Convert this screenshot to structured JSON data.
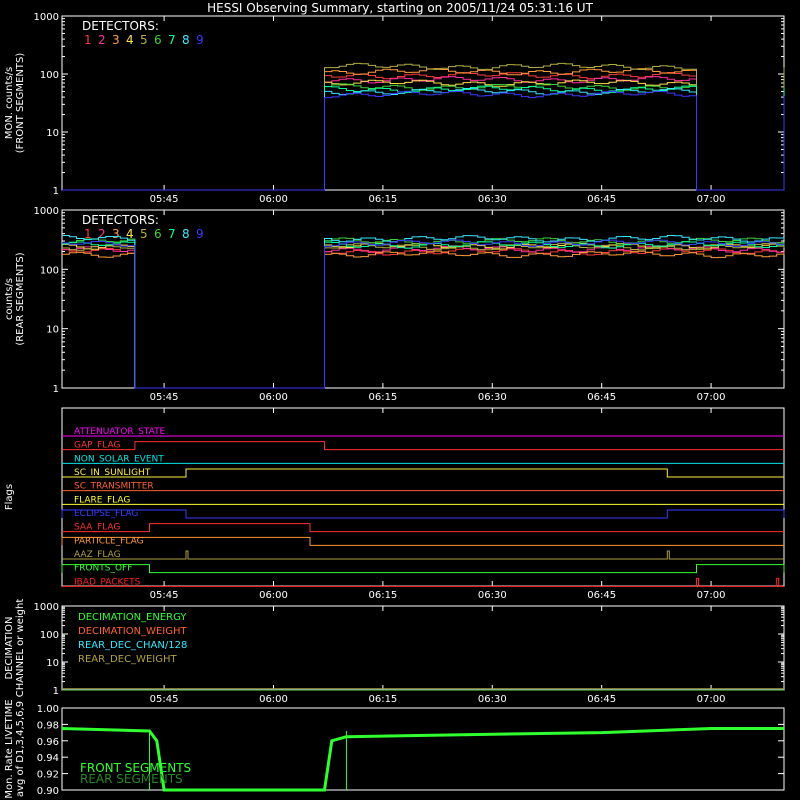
{
  "title": "HESSI Observing Summary, starting on 2005/11/24 05:31:16 UT",
  "colors": {
    "background": "#000000",
    "foreground": "#ffffff",
    "detectors": [
      "#ff3a3a",
      "#ff2fa0",
      "#ff9a3a",
      "#ffe34a",
      "#b0b040",
      "#3ad23a",
      "#00ff9a",
      "#35e8ff",
      "#3a3aff"
    ]
  },
  "chart_data": [
    {
      "type": "line",
      "name": "front-rates",
      "ylabel": [
        "MON. counts/s",
        "(FRONT SEGMENTS)"
      ],
      "yscale": "log",
      "ylim": [
        1,
        1000
      ],
      "yticks": [
        "1",
        "10",
        "100",
        "1000"
      ],
      "xticks": [
        "05:45",
        "06:00",
        "06:15",
        "06:30",
        "06:45",
        "07:00"
      ],
      "legend_title": "DETECTORS:",
      "legend_labels": [
        "1",
        "2",
        "3",
        "4",
        "5",
        "6",
        "7",
        "8",
        "9"
      ],
      "gaps": [
        [
          "05:31",
          "06:07"
        ],
        [
          "06:58",
          "07:10"
        ]
      ],
      "series_levels": [
        95,
        80,
        110,
        70,
        135,
        60,
        55,
        50,
        45
      ]
    },
    {
      "type": "line",
      "name": "rear-rates",
      "ylabel": [
        "counts/s",
        "(REAR SEGMENTS)"
      ],
      "yscale": "log",
      "ylim": [
        1,
        1000
      ],
      "yticks": [
        "1",
        "10",
        "100",
        "1000"
      ],
      "xticks": [
        "05:45",
        "06:00",
        "06:15",
        "06:30",
        "06:45",
        "07:00"
      ],
      "legend_title": "DETECTORS:",
      "legend_labels": [
        "1",
        "2",
        "3",
        "4",
        "5",
        "6",
        "7",
        "8",
        "9"
      ],
      "gaps": [
        [
          "05:41",
          "06:07"
        ]
      ],
      "series_levels": [
        200,
        220,
        180,
        250,
        240,
        300,
        260,
        330,
        280
      ]
    },
    {
      "type": "flags",
      "name": "flags",
      "ylabel": [
        "Flags"
      ],
      "xticks": [
        "05:45",
        "06:00",
        "06:15",
        "06:30",
        "06:45",
        "07:00"
      ],
      "flags": [
        {
          "label": "ATTENUATOR_STATE",
          "color": "#ff00ff",
          "segments": []
        },
        {
          "label": "GAP_FLAG",
          "color": "#ff3030",
          "segments": [
            [
              "05:41",
              "06:07"
            ]
          ]
        },
        {
          "label": "NON_SOLAR_EVENT",
          "color": "#00e5e5",
          "segments": []
        },
        {
          "label": "SC_IN_SUNLIGHT",
          "color": "#ffee44",
          "segments": [
            [
              "05:48",
              "06:54"
            ]
          ]
        },
        {
          "label": "SC_TRANSMITTER",
          "color": "#ff6030",
          "segments": []
        },
        {
          "label": "FLARE_FLAG",
          "color": "#ffff30",
          "segments": []
        },
        {
          "label": "ECLIPSE_FLAG",
          "color": "#3a3aff",
          "segments": [
            [
              "05:31",
              "05:48"
            ],
            [
              "06:54",
              "07:10"
            ]
          ]
        },
        {
          "label": "SAA_FLAG",
          "color": "#ff3030",
          "segments": [
            [
              "05:43",
              "06:05"
            ]
          ]
        },
        {
          "label": "PARTICLE_FLAG",
          "color": "#ff9930",
          "segments": [
            [
              "05:31",
              "06:05"
            ]
          ]
        },
        {
          "label": "AAZ_FLAG",
          "color": "#b0a040",
          "segments": [
            [
              "05:48",
              "05:48"
            ],
            [
              "06:54",
              "06:54"
            ]
          ]
        },
        {
          "label": "FRONTS_OFF",
          "color": "#30ff30",
          "segments": [
            [
              "05:31",
              "05:43"
            ],
            [
              "06:58",
              "07:10"
            ]
          ]
        },
        {
          "label": "IBAD_PACKETS",
          "color": "#ff2020",
          "segments": [
            [
              "06:58",
              "06:58"
            ],
            [
              "07:09",
              "07:09"
            ]
          ]
        }
      ]
    },
    {
      "type": "line",
      "name": "decimation",
      "ylabel": [
        "DECIMATION",
        "CHANNEL or weight"
      ],
      "yscale": "log",
      "ylim": [
        1,
        1000
      ],
      "yticks": [
        "1",
        "10",
        "100",
        "1000"
      ],
      "xticks": [
        "05:45",
        "06:00",
        "06:15",
        "06:30",
        "06:45",
        "07:00"
      ],
      "series": [
        {
          "name": "DECIMATION_ENERGY",
          "color": "#30ff30",
          "value": 1
        },
        {
          "name": "DECIMATION_WEIGHT",
          "color": "#ff6030",
          "value": 1
        },
        {
          "name": "REAR_DEC_CHAN/128",
          "color": "#35e8ff",
          "value": 1
        },
        {
          "name": "REAR_DEC_WEIGHT",
          "color": "#b0a040",
          "value": 1
        }
      ]
    },
    {
      "type": "line",
      "name": "livetime",
      "ylabel": [
        "Mon. Rate LIVETIME",
        "avg of D1,3,4,5,6,9"
      ],
      "ylim": [
        0.9,
        1.0
      ],
      "yticks": [
        "0.90",
        "0.92",
        "0.94",
        "0.96",
        "0.98",
        "1.00"
      ],
      "xticks": [],
      "series": [
        {
          "name": "FRONT SEGMENTS",
          "color": "#30ff30"
        },
        {
          "name": "REAR SEGMENTS",
          "color": "#208820"
        }
      ],
      "front_points": [
        [
          "05:31",
          0.975
        ],
        [
          "05:43",
          0.972
        ],
        [
          "05:44",
          0.96
        ],
        [
          "05:45",
          0.9
        ],
        [
          "06:07",
          0.9
        ],
        [
          "06:08",
          0.96
        ],
        [
          "06:10",
          0.965
        ],
        [
          "06:30",
          0.968
        ],
        [
          "06:45",
          0.97
        ],
        [
          "07:00",
          0.975
        ],
        [
          "07:10",
          0.975
        ]
      ]
    }
  ]
}
